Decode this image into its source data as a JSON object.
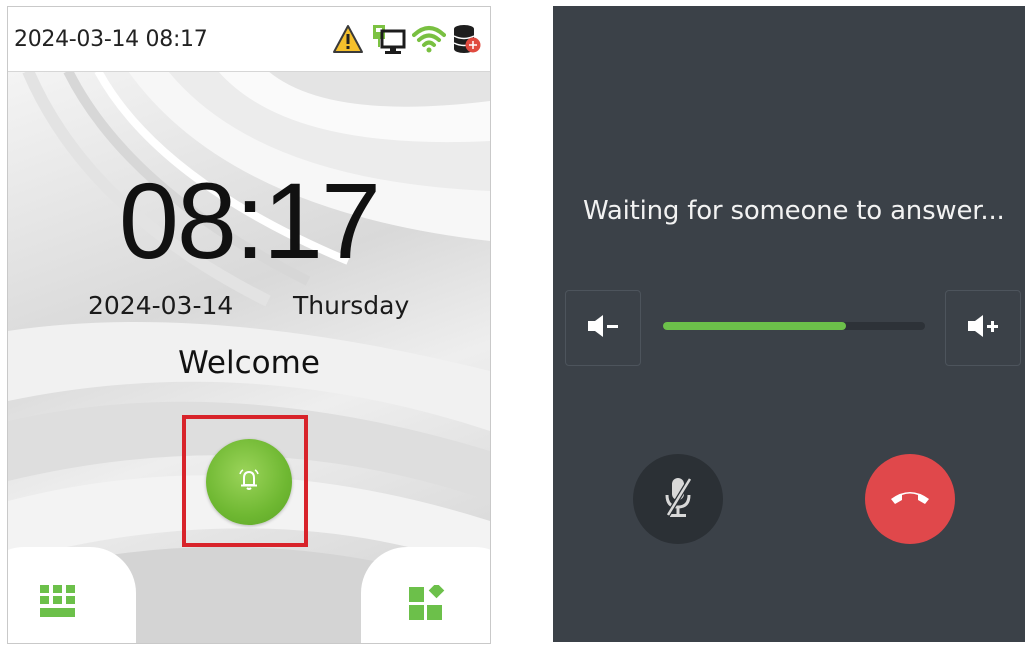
{
  "left_screen": {
    "status_bar": {
      "datetime": "2024-03-14 08:17",
      "icons": [
        "warning-icon",
        "network-monitor-icon",
        "wifi-icon",
        "database-icon"
      ]
    },
    "clock": "08:17",
    "date": "2024-03-14",
    "weekday": "Thursday",
    "welcome": "Welcome",
    "doorbell_button": {
      "icon": "bell-icon",
      "color": "#6fb832",
      "highlight_color": "#d8232a"
    },
    "menu_left_icon": "keypad-icon",
    "menu_right_icon": "shortcut-icon",
    "accent_color": "#6cc04a"
  },
  "right_screen": {
    "status_text": "Waiting for someone to answer...",
    "volume": {
      "level": 0.7,
      "down_icon": "volume-down-icon",
      "up_icon": "volume-up-icon"
    },
    "mute_button_icon": "microphone-muted-icon",
    "hangup_button_icon": "hangup-icon",
    "hangup_color": "#e0484b",
    "background_color": "#3b4148"
  }
}
